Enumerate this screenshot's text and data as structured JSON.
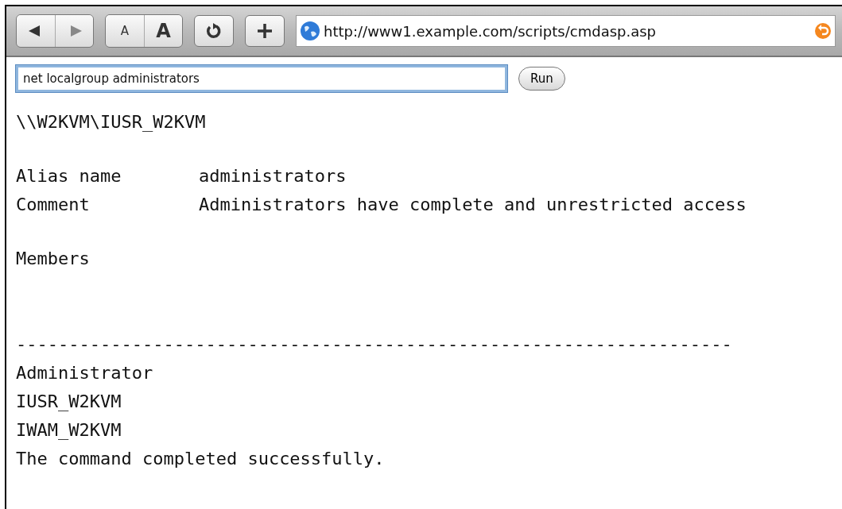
{
  "toolbar": {
    "address": "http://www1.example.com/scripts/cmdasp.asp",
    "small_text_button": "A",
    "large_text_button": "A"
  },
  "form": {
    "command": "net localgroup administrators",
    "run_button": "Run"
  },
  "output": {
    "user": "\\\\W2KVM\\IUSR_W2KVM",
    "properties": [
      {
        "label": "Alias name",
        "value": "administrators"
      },
      {
        "label": "Comment",
        "value": "Administrators have complete and unrestricted access"
      }
    ],
    "members_heading": "Members",
    "separator": "--------------------------------------------------------------------",
    "members": [
      "Administrator",
      "IUSR_W2KVM",
      "IWAM_W2KVM"
    ],
    "result": "The command completed successfully."
  }
}
